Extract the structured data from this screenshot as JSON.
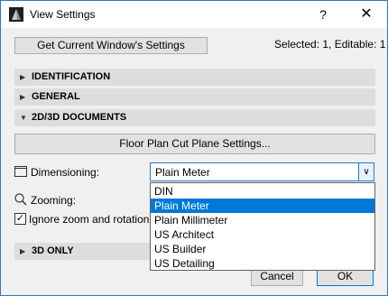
{
  "window": {
    "title": "View Settings",
    "help": "?",
    "close": "✕"
  },
  "toolbar": {
    "get_current": "Get Current Window's Settings",
    "selected_info": "Selected: 1, Editable: 1"
  },
  "sections": {
    "identification": "IDENTIFICATION",
    "general": "GENERAL",
    "documents": "2D/3D DOCUMENTS",
    "only3d": "3D ONLY"
  },
  "documents": {
    "floor_plan_button": "Floor Plan Cut Plane Settings...",
    "dimensioning_label": "Dimensioning:",
    "dimensioning_value": "Plain Meter",
    "zooming_label": "Zooming:",
    "ignore_label": "Ignore zoom and rotation",
    "ignore_checked": true,
    "ignore_mark": "✓"
  },
  "dropdown": {
    "options": [
      "DIN",
      "Plain Meter",
      "Plain Millimeter",
      "US Architect",
      "US Builder",
      "US Detailing"
    ],
    "selected_index": 1
  },
  "buttons": {
    "cancel": "Cancel",
    "ok": "OK"
  },
  "icons": {
    "expand": "▶",
    "collapse": "▼",
    "chevron": "∨"
  },
  "colors": {
    "accent": "#0078d7",
    "border": "#2b78c5",
    "section_bg": "#dddddd"
  }
}
